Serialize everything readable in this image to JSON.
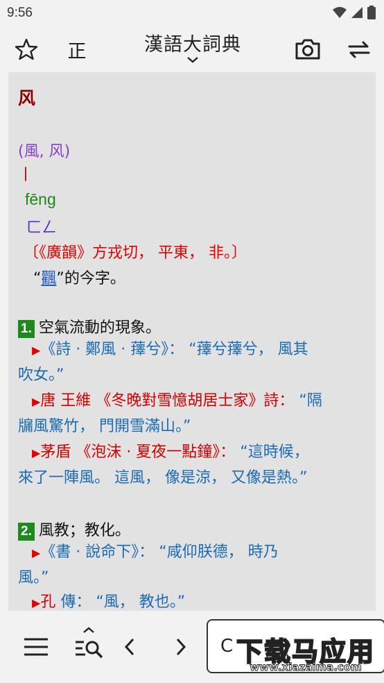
{
  "status": {
    "time": "9:56"
  },
  "toolbar": {
    "title": "漢語大詞典",
    "variant_label": "正"
  },
  "entry": {
    "headword": "风",
    "variants": "(風, 风)",
    "radical": "丨",
    "pinyin": "fēng",
    "zhuyin": "ㄈㄥ",
    "source": "〔《廣韻》方戎切， 平東， 非。〕",
    "link_prefix": "“",
    "link_word": "飌",
    "link_suffix": "”的今字。",
    "senses": [
      {
        "num": "1.",
        "gloss": "空氣流動的現象。",
        "citations": [
          {
            "author": "",
            "source": "《詩 · 鄭風 · 蘀兮》：",
            "quote_1": "“蘀兮蘀兮， 風其",
            "quote_2": "吹女。”"
          },
          {
            "author": "唐 王維",
            "source": "《冬晚對雪憶胡居士家》詩：",
            "quote_1": "“隔",
            "quote_2": "牖風驚竹， 門開雪滿山。”"
          },
          {
            "author": "茅盾",
            "source": "《泡沫 · 夏夜一點鐘》：",
            "quote_1": "“這時候，",
            "quote_2": "來了一陣風。 這風， 像是涼， 又像是熱。”"
          }
        ]
      },
      {
        "num": "2.",
        "gloss": "風教；教化。",
        "citations": [
          {
            "author": "",
            "source": "《書 · 說命下》：",
            "quote_1": "“咸仰朕德， 時乃",
            "quote_2": "風。”"
          },
          {
            "author": "孔",
            "source": "傳：",
            "quote_1": "“風， 教也。”",
            "quote_2": ""
          }
        ]
      }
    ]
  },
  "bottom": {
    "search_value": "C",
    "watermark_big": "下载马应用",
    "watermark_small": "www.xiazaima.com"
  },
  "colors": {
    "accent_green": "#1e8a1e",
    "source_red": "#e00000",
    "quote_blue": "#1a6ab4",
    "headword": "#8b0000"
  }
}
